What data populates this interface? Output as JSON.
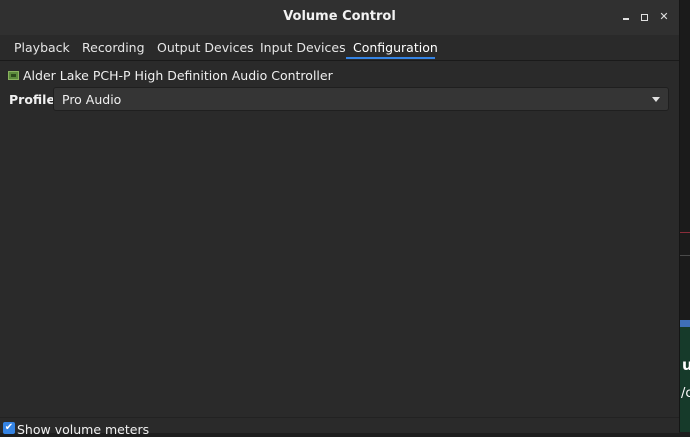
{
  "window": {
    "title": "Volume Control"
  },
  "tabs": [
    {
      "label": "Playback"
    },
    {
      "label": "Recording"
    },
    {
      "label": "Output Devices"
    },
    {
      "label": "Input Devices"
    },
    {
      "label": "Configuration",
      "active": true
    }
  ],
  "configuration": {
    "card_name": "Alder Lake PCH-P High Definition Audio Controller",
    "card_icon": "sound-card-icon",
    "profile_label": "Profile:",
    "profile_value": "Pro Audio"
  },
  "footer": {
    "show_volume_meters_label": "Show volume meters",
    "show_volume_meters_checked": true
  },
  "background_fragments": {
    "line1": "u",
    "line2": "/c"
  },
  "colors": {
    "accent": "#3584e4",
    "window_bg": "#2a2a2a",
    "titlebar_bg": "#303030"
  }
}
